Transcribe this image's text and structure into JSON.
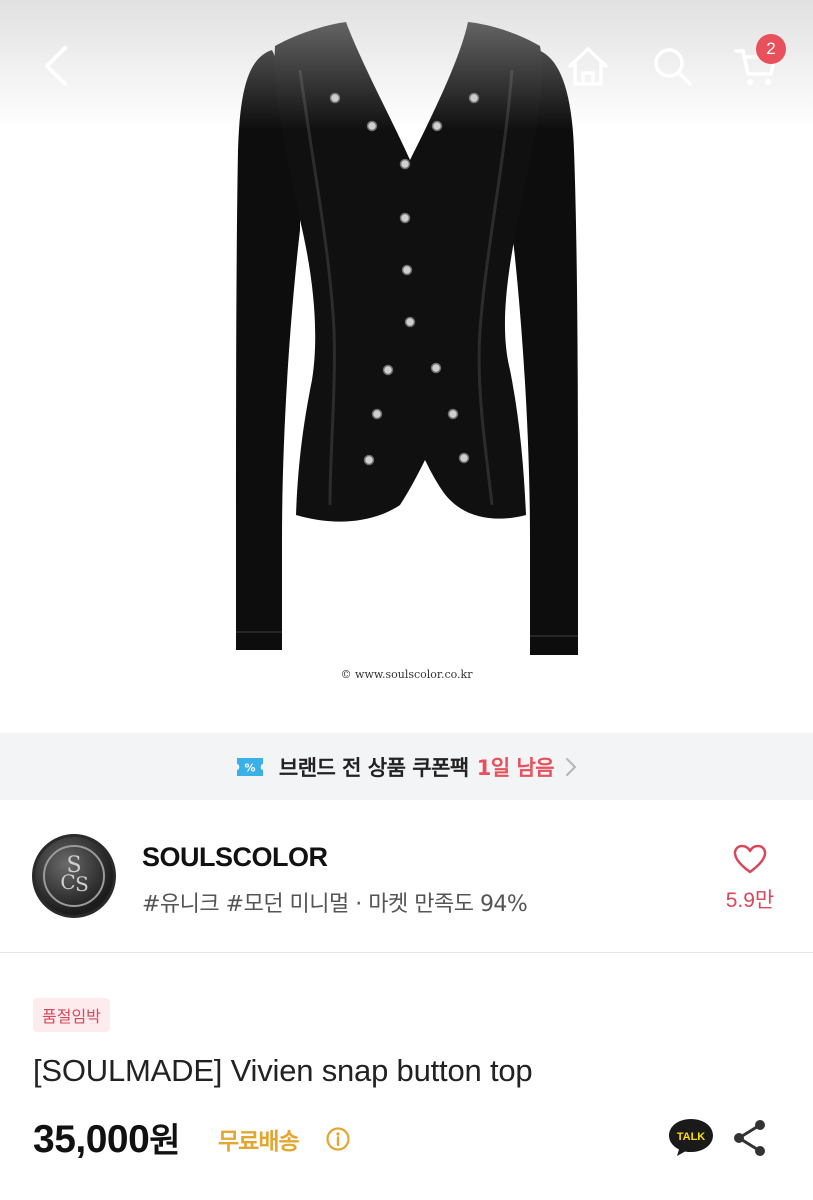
{
  "product_image": {
    "watermark": "© www.soulscolor.co.kr"
  },
  "top_bar": {
    "back_icon": "chevron-left-icon",
    "home_icon": "home-icon",
    "search_icon": "search-icon",
    "cart_icon": "cart-icon",
    "cart_count": "2"
  },
  "coupon_banner": {
    "icon": "coupon-ticket-icon",
    "text": "브랜드 전 상품 쿠폰팩",
    "days_left": "1일 남음",
    "accent_color": "#e8505b"
  },
  "store": {
    "name": "SOULSCOLOR",
    "tags": "#유니크 #모던 미니멀 · 마켓 만족도 94%",
    "like_count": "5.9만"
  },
  "product": {
    "status_badge": "품절임박",
    "title": "[SOULMADE] Vivien snap button top",
    "price": "35,000",
    "price_unit": "원",
    "shipping": "무료배송",
    "shipping_color": "#e5a630",
    "talk_label": "TALK"
  }
}
